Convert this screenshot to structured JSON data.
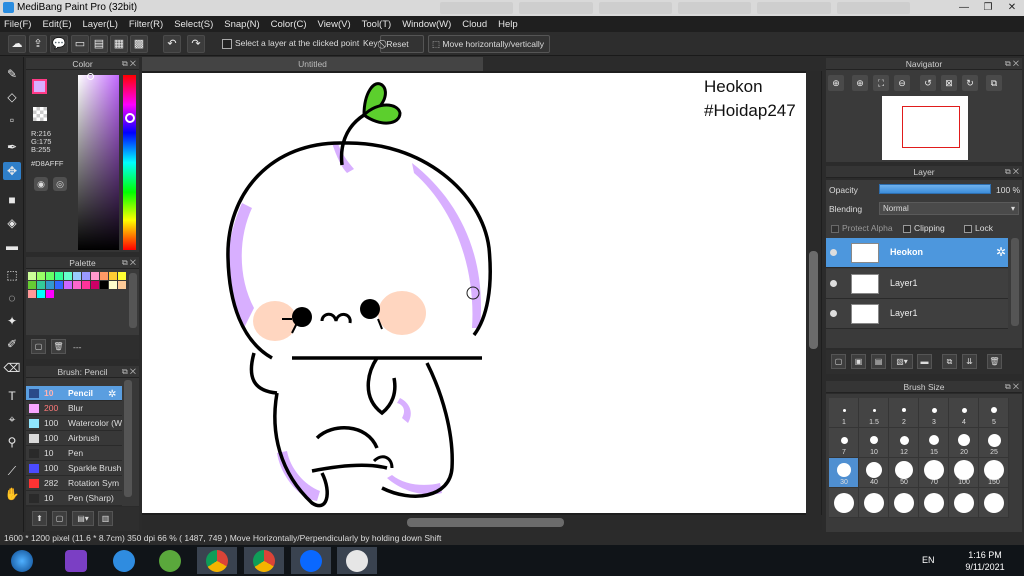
{
  "window": {
    "title": "MediBang Paint Pro (32bit)"
  },
  "menu": [
    "File(F)",
    "Edit(E)",
    "Layer(L)",
    "Filter(R)",
    "Select(S)",
    "Snap(N)",
    "Color(C)",
    "View(V)",
    "Tool(T)",
    "Window(W)",
    "Cloud",
    "Help"
  ],
  "toolbar": {
    "select_layer_label": "Select a layer at the clicked point",
    "key_label": "Key",
    "reset_label": "Reset",
    "move_mode": "Move horizontally/vertically"
  },
  "color_panel": {
    "title": "Color",
    "current_color": "#D8AFFF",
    "r": "R:216",
    "g": "G:175",
    "b": "B:255",
    "hex": "#D8AFFF"
  },
  "palette_panel": {
    "title": "Palette",
    "footer_text": "---",
    "colors": [
      "#ccff99",
      "#99ff66",
      "#66ff66",
      "#33ff99",
      "#66ffcc",
      "#99ccff",
      "#9999ff",
      "#ff99cc",
      "#ff9966",
      "#ffcc33",
      "#ffff33",
      "#66cc33",
      "#33cc99",
      "#3399cc",
      "#3366ff",
      "#cc66ff",
      "#ff66cc",
      "#ff3399",
      "#cc0066",
      "#000000",
      "#ffffcc",
      "#ffcc99",
      "#ff9999",
      "#00ffff",
      "#ff00ff"
    ]
  },
  "brush_panel": {
    "title": "Brush: Pencil",
    "brushes": [
      {
        "size": "10",
        "name": "Pencil",
        "color": "#2a4a8a"
      },
      {
        "size": "200",
        "name": "Blur",
        "color": "#f7a6ff"
      },
      {
        "size": "100",
        "name": "Watercolor (W",
        "color": "#8fe7ff"
      },
      {
        "size": "100",
        "name": "Airbrush",
        "color": "#d9d9d9"
      },
      {
        "size": "10",
        "name": "Pen",
        "color": "#2a2a2a"
      },
      {
        "size": "100",
        "name": "Sparkle Brush",
        "color": "#4b4bff"
      },
      {
        "size": "282",
        "name": "Rotation Sym",
        "color": "#ff3333"
      },
      {
        "size": "10",
        "name": "Pen (Sharp)",
        "color": "#2a2a2a"
      }
    ]
  },
  "canvas": {
    "tab_title": "Untitled",
    "watermark_line1": "Heokon",
    "watermark_line2": "#Hoidap247"
  },
  "navigator": {
    "title": "Navigator"
  },
  "layer_panel": {
    "title": "Layer",
    "opacity_label": "Opacity",
    "opacity_value": "100 %",
    "opacity_fraction": 1.0,
    "blending_label": "Blending",
    "blending_value": "Normal",
    "protect_alpha": "Protect Alpha",
    "clipping": "Clipping",
    "lock": "Lock",
    "layers": [
      {
        "name": "Heokon",
        "selected": true
      },
      {
        "name": "Layer1",
        "selected": false
      },
      {
        "name": "Layer1",
        "selected": false
      }
    ]
  },
  "brush_size_panel": {
    "title": "Brush Size",
    "sizes": [
      "1",
      "1.5",
      "2",
      "3",
      "4",
      "5",
      "7",
      "10",
      "12",
      "15",
      "20",
      "25",
      "30",
      "40",
      "50",
      "70",
      "100",
      "150",
      "",
      "",
      "",
      "",
      "",
      ""
    ],
    "selected": "30"
  },
  "status": {
    "text": "1600 * 1200 pixel  (11.6 * 8.7cm)  350 dpi  66 %  ( 1487, 749 )  Move Horizontally/Perpendicularly by holding down Shift"
  },
  "taskbar": {
    "language": "EN",
    "time": "1:16 PM",
    "date": "9/11/2021"
  }
}
